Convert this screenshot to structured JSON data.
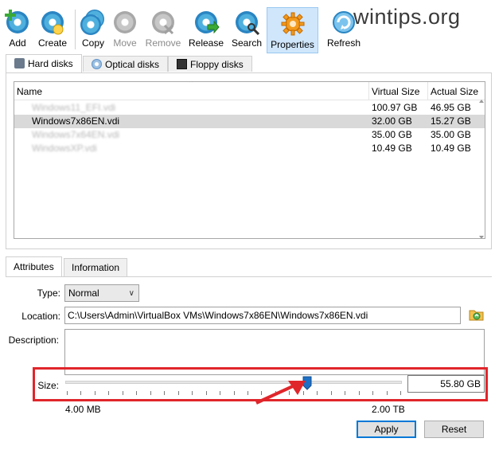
{
  "toolbar": {
    "buttons": [
      {
        "label": "Add",
        "icon": "add-disk-icon",
        "enabled": true
      },
      {
        "label": "Create",
        "icon": "create-disk-icon",
        "enabled": true
      },
      {
        "label": "Copy",
        "icon": "copy-disk-icon",
        "enabled": true
      },
      {
        "label": "Move",
        "icon": "move-disk-icon",
        "enabled": false
      },
      {
        "label": "Remove",
        "icon": "remove-disk-icon",
        "enabled": false
      },
      {
        "label": "Release",
        "icon": "release-disk-icon",
        "enabled": true
      },
      {
        "label": "Search",
        "icon": "search-disk-icon",
        "enabled": true
      },
      {
        "label": "Properties",
        "icon": "properties-gear-icon",
        "enabled": true,
        "active": true
      },
      {
        "label": "Refresh",
        "icon": "refresh-icon",
        "enabled": true
      }
    ],
    "watermark": "wintips.org"
  },
  "media_tabs": [
    {
      "label": "Hard disks",
      "icon": "hard-disk-icon",
      "selected": true
    },
    {
      "label": "Optical disks",
      "icon": "optical-disk-icon",
      "selected": false
    },
    {
      "label": "Floppy disks",
      "icon": "floppy-disk-icon",
      "selected": false
    }
  ],
  "disk_list": {
    "columns": [
      "Name",
      "Virtual Size",
      "Actual Size"
    ],
    "rows": [
      {
        "name": "Windows11_EFI.vdi",
        "virtual_size": "100.97 GB",
        "actual_size": "46.95 GB",
        "obscured": true,
        "selected": false
      },
      {
        "name": "Windows7x86EN.vdi",
        "virtual_size": "32.00 GB",
        "actual_size": "15.27 GB",
        "obscured": false,
        "selected": true
      },
      {
        "name": "Windows7x64EN.vdi",
        "virtual_size": "35.00 GB",
        "actual_size": "35.00 GB",
        "obscured": true,
        "selected": false
      },
      {
        "name": "WindowsXP.vdi",
        "virtual_size": "10.49 GB",
        "actual_size": "10.49 GB",
        "obscured": true,
        "selected": false
      }
    ]
  },
  "details_tabs": [
    {
      "label": "Attributes",
      "selected": true
    },
    {
      "label": "Information",
      "selected": false
    }
  ],
  "attributes": {
    "type_label": "Type:",
    "type_value": "Normal",
    "location_label": "Location:",
    "location_value": "C:\\Users\\Admin\\VirtualBox VMs\\Windows7x86EN\\Windows7x86EN.vdi",
    "description_label": "Description:",
    "description_value": "",
    "size_label": "Size:",
    "size_value": "55.80 GB",
    "size_min": "4.00 MB",
    "size_max": "2.00 TB",
    "slider_fraction": 0.72
  },
  "buttons": {
    "apply": "Apply",
    "reset": "Reset"
  },
  "colors": {
    "highlight_box": "#e0262b",
    "slider_thumb": "#1f6fc5",
    "selected_row": "#d9d9d9",
    "active_toolbar": "#cfe6fb"
  }
}
